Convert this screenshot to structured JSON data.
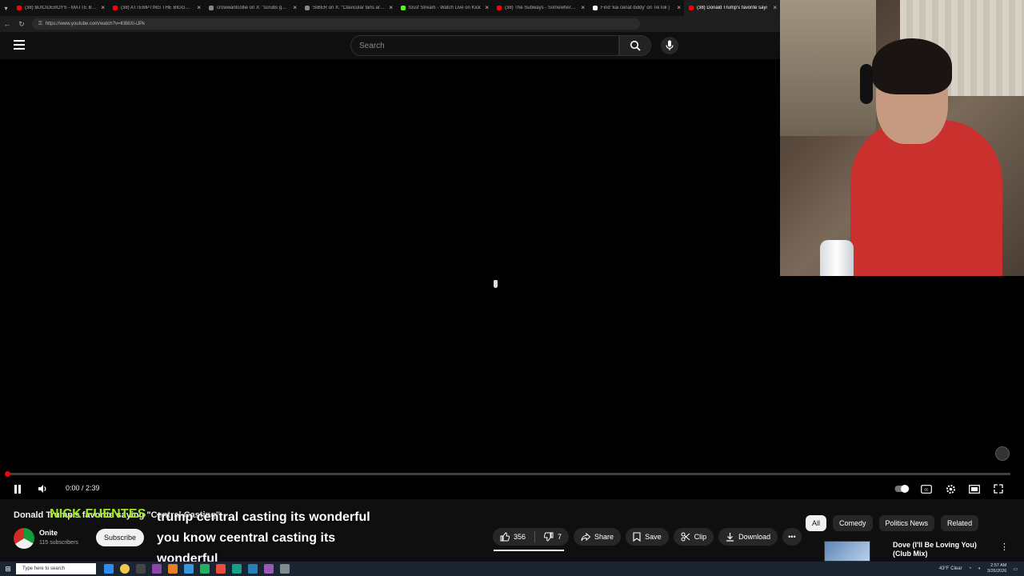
{
  "browser": {
    "tabs": [
      {
        "title": "(38) $UICIDEBOYS - MATTE BLAC",
        "color": "#ff0000",
        "active": false
      },
      {
        "title": "(38) ATTEMPTING THE BIGGEST E",
        "color": "#ff0000",
        "active": false
      },
      {
        "title": "crowwantcollie on X: \"scrubs gets u",
        "color": "#888888",
        "active": false
      },
      {
        "title": "SIBER on X: \"Clavicular fans are S",
        "color": "#888888",
        "active": false
      },
      {
        "title": "fossf Stream - Watch Live on Kick",
        "color": "#53fc18",
        "active": false
      },
      {
        "title": "(38) The Subways - Somewhere (C",
        "color": "#ff0000",
        "active": false
      },
      {
        "title": "Find 'kai cenat diddy' on TikTok |",
        "color": "#ffffff",
        "active": false
      },
      {
        "title": "(38) Donald Trump's favorite sayi",
        "color": "#ff0000",
        "active": true
      }
    ],
    "url": "https://www.youtube.com/watch?v=Kl88Xl-iJPk"
  },
  "header": {
    "search_placeholder": "Search"
  },
  "player": {
    "time": "0:00 / 2:39",
    "progress": 0.002
  },
  "video": {
    "title": "Donald Trump's favorite saying \"Central Casting\"",
    "overlay_name": "NICK FUENTES",
    "caption": "trump central casting its wonderful you know ceentral casting its wonderful"
  },
  "channel": {
    "name": "Onite",
    "subscribers": "115 subscribers",
    "subscribe_label": "Subscribe"
  },
  "actions": {
    "likes": "356",
    "dislikes": "7",
    "share": "Share",
    "save": "Save",
    "clip": "Clip",
    "download": "Download",
    "more": "•••"
  },
  "chips": [
    {
      "label": "All",
      "active": true
    },
    {
      "label": "Comedy",
      "active": false
    },
    {
      "label": "Politics News",
      "active": false
    },
    {
      "label": "Related",
      "active": false
    }
  ],
  "recommendation": {
    "title": "Dove (I'll Be Loving You) (Club Mix)"
  },
  "taskbar": {
    "search_placeholder": "Type here to search",
    "weather": "43°F Clear",
    "time": "2:57 AM",
    "date": "3/26/2026"
  }
}
